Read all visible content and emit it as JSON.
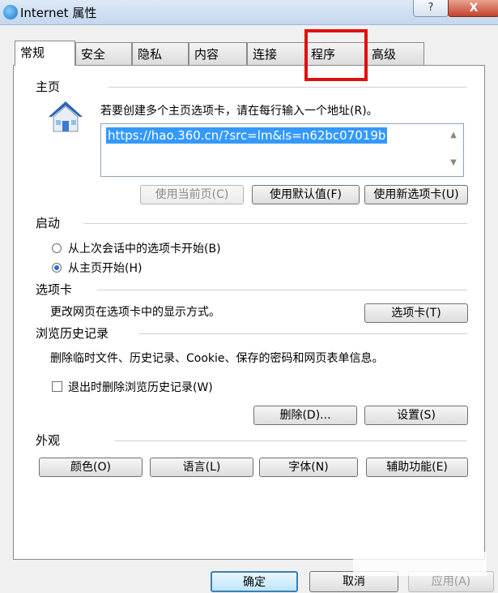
{
  "window": {
    "title": "Internet 属性",
    "help_label": "?",
    "close_label": "X"
  },
  "tabs": [
    {
      "label": "常规",
      "active": true
    },
    {
      "label": "安全"
    },
    {
      "label": "隐私"
    },
    {
      "label": "内容"
    },
    {
      "label": "连接"
    },
    {
      "label": "程序",
      "highlighted": true
    },
    {
      "label": "高级"
    }
  ],
  "home": {
    "section_label": "主页",
    "instruction": "若要创建多个主页选项卡，请在每行输入一个地址(R)。",
    "url": "https://hao.360.cn/?src=lm&ls=n62bc07019b",
    "buttons": {
      "use_current": "使用当前页(C)",
      "use_default": "使用默认值(F)",
      "use_new_tab": "使用新选项卡(U)"
    }
  },
  "startup": {
    "section_label": "启动",
    "option_last_session": "从上次会话中的选项卡开始(B)",
    "option_home": "从主页开始(H)"
  },
  "tabs_section": {
    "section_label": "选项卡",
    "description": "更改网页在选项卡中的显示方式。",
    "button": "选项卡(T)"
  },
  "history": {
    "section_label": "浏览历史记录",
    "description": "删除临时文件、历史记录、Cookie、保存的密码和网页表单信息。",
    "checkbox_label": "退出时删除浏览历史记录(W)",
    "delete_button": "删除(D)...",
    "settings_button": "设置(S)"
  },
  "appearance": {
    "section_label": "外观",
    "colors_button": "颜色(O)",
    "languages_button": "语言(L)",
    "fonts_button": "字体(N)",
    "accessibility_button": "辅助功能(E)"
  },
  "footer": {
    "ok": "确定",
    "cancel": "取消",
    "apply": "应用(A)"
  },
  "colors": {
    "highlight_box": "#e01010",
    "selection": "#3399ff"
  },
  "icons": {
    "title": "ie-globe-icon",
    "home": "house-icon"
  }
}
